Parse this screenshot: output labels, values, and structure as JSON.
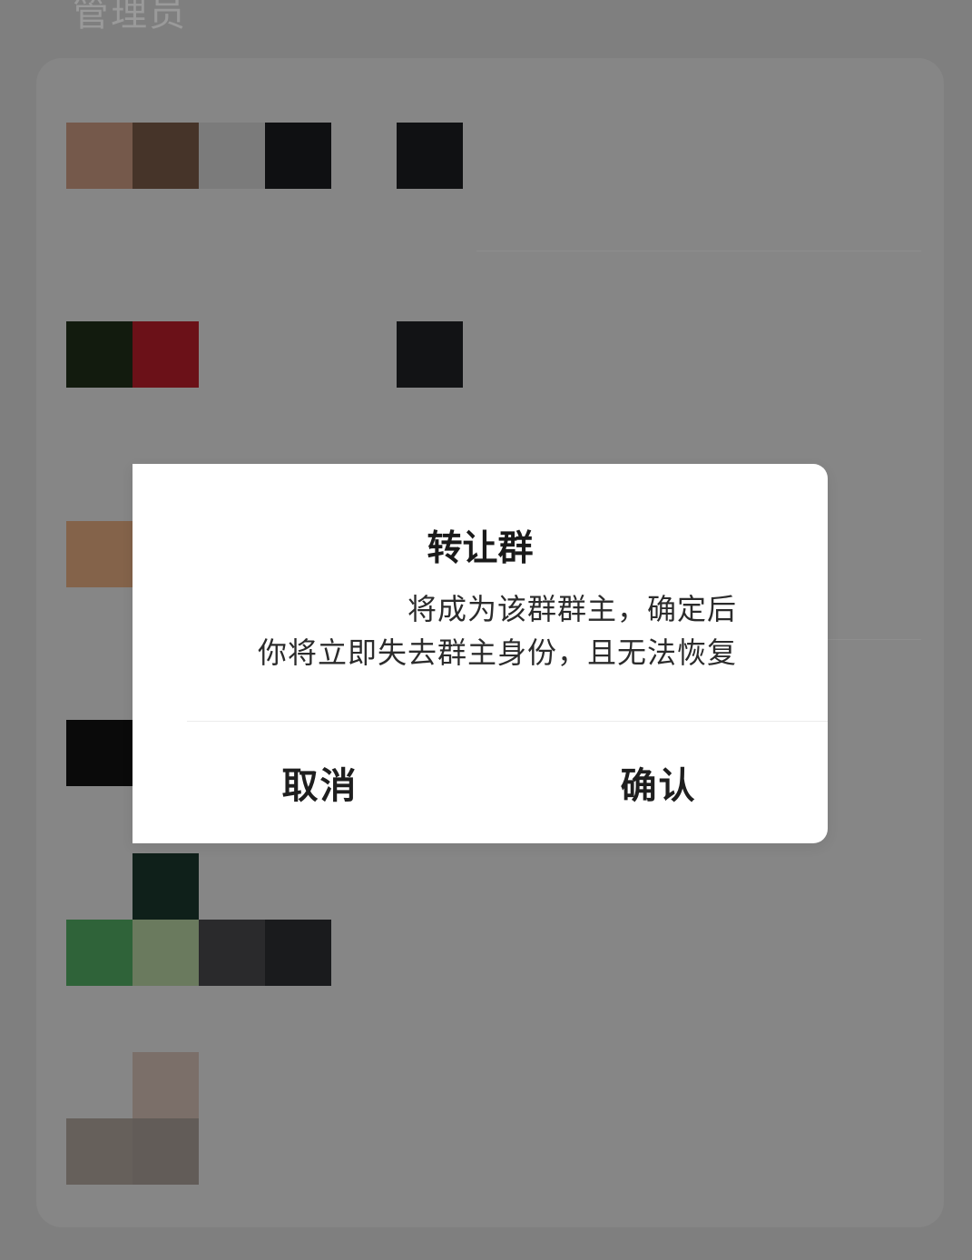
{
  "section": {
    "title": "管理员"
  },
  "dialog": {
    "title": "转让群",
    "message_line1": "将成为该群群主，确定后",
    "message_line2": "你将立即失去群主身份，且无法恢复",
    "cancel_label": "取消",
    "confirm_label": "确认"
  },
  "colors": {
    "background": "#7f7f7f",
    "card": "#868686",
    "dialog": "#ffffff",
    "text": "#1a1a1a"
  }
}
